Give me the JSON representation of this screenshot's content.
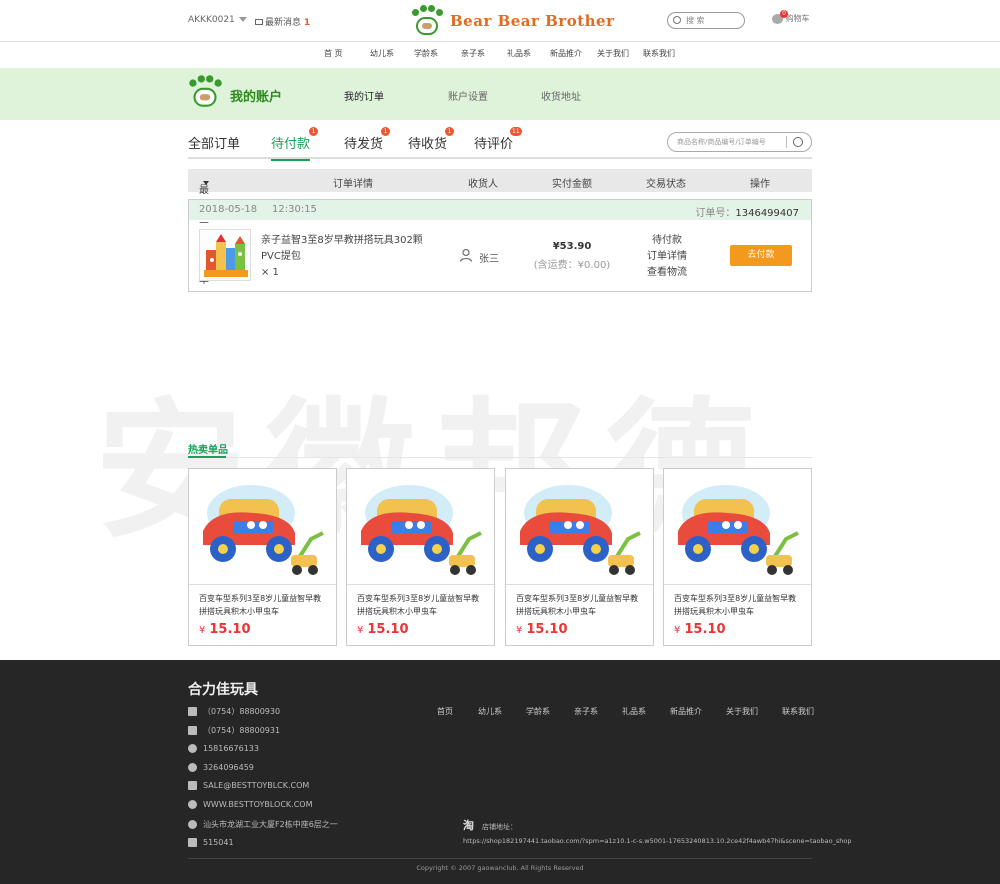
{
  "topbar": {
    "username": "AKKK0021",
    "messages_label": "最新消息",
    "messages_count": "1",
    "logo_text": "Bear Bear Brother",
    "search_placeholder": "搜 索",
    "cart_label": "购物车",
    "cart_count": "0"
  },
  "mainnav": {
    "items": [
      "首 页",
      "幼儿系",
      "学龄系",
      "亲子系",
      "礼品系",
      "新品推介",
      "关于我们",
      "联系我们"
    ]
  },
  "account": {
    "title": "我的账户",
    "tabs": [
      "我的订单",
      "账户设置",
      "收货地址"
    ]
  },
  "order_tabs": {
    "items": [
      {
        "label": "全部订单",
        "badge": ""
      },
      {
        "label": "待付款",
        "badge": "1"
      },
      {
        "label": "待发货",
        "badge": "1"
      },
      {
        "label": "待收货",
        "badge": "1"
      },
      {
        "label": "待评价",
        "badge": "11"
      }
    ],
    "search_placeholder": "商品名称/商品编号/订单编号"
  },
  "table": {
    "headers": [
      "最近三个月订单",
      "订单详情",
      "收货人",
      "实付金额",
      "交易状态",
      "操作"
    ]
  },
  "order": {
    "date": "2018-05-18",
    "time": "12:30:15",
    "order_no_label": "订单号：",
    "order_no": "1346499407",
    "product_name": "亲子益智3至8岁早教拼搭玩具302颗PVC提包",
    "quantity": "× 1",
    "recipient": "张三",
    "price": "¥53.90",
    "shipping": "(含运费：¥0.00)",
    "status_links": [
      "待付款",
      "订单详情",
      "查看物流"
    ],
    "pay_button": "去付款"
  },
  "watermark": "安徽邦德",
  "hot": {
    "title": "热卖单品",
    "items": [
      {
        "name": "百变车型系列3至8岁儿童益智早教拼搭玩具积木小甲虫车",
        "price": "15.10"
      },
      {
        "name": "百变车型系列3至8岁儿童益智早教拼搭玩具积木小甲虫车",
        "price": "15.10"
      },
      {
        "name": "百变车型系列3至8岁儿童益智早教拼搭玩具积木小甲虫车",
        "price": "15.10"
      },
      {
        "name": "百变车型系列3至8岁儿童益智早教拼搭玩具积木小甲虫车",
        "price": "15.10"
      }
    ],
    "currency": "¥"
  },
  "footer": {
    "company": "合力佳玩具",
    "contacts": [
      {
        "icon": "phone-icon",
        "text": "（0754）88800930"
      },
      {
        "icon": "fax-icon",
        "text": "（0754）88800931"
      },
      {
        "icon": "wechat-icon",
        "text": "15816676133"
      },
      {
        "icon": "qq-icon",
        "text": "3264096459"
      },
      {
        "icon": "mail-icon",
        "text": "SALE@BESTTOYBLCK.COM"
      },
      {
        "icon": "globe-icon",
        "text": "WWW.BESTTOYBLOCK.COM"
      },
      {
        "icon": "location-icon",
        "text": "汕头市龙湖工业大厦F2栋中座6层之一"
      },
      {
        "icon": "postcode-icon",
        "text": "515041"
      }
    ],
    "nav": [
      "首页",
      "幼儿系",
      "学龄系",
      "亲子系",
      "礼品系",
      "新品推介",
      "关于我们",
      "联系我们"
    ],
    "taobao_icon": "淘",
    "shop_label": "店铺地址：",
    "shop_url": "https://shop182197441.taobao.com/?spm=a1z10.1-c-s.w5001-17653240813.10.2ce42f4awb47hi&scene=taobao_shop",
    "copyright": "Copyright © 2007 gaowanclub. All Rights Reserved"
  }
}
